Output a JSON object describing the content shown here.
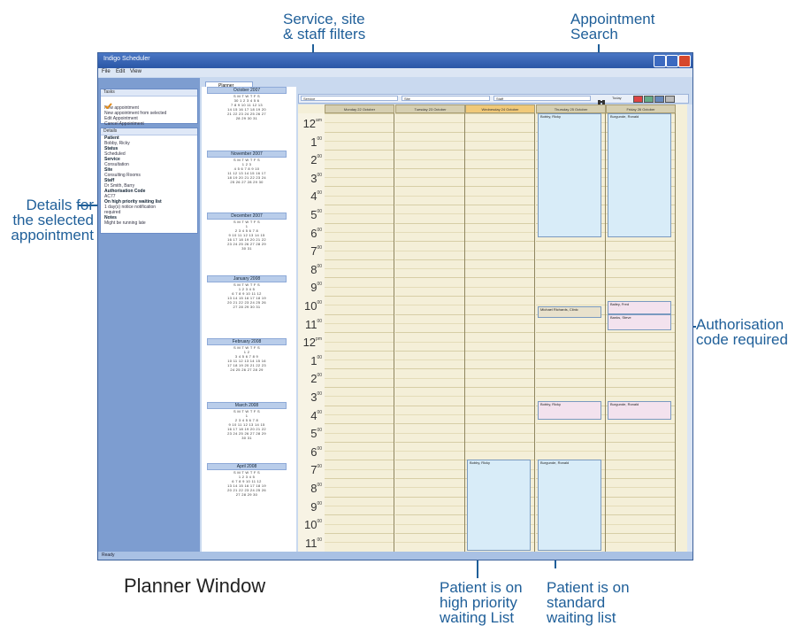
{
  "callouts": {
    "filters": "Service, site\n& staff filters",
    "filters_l1": "Service, site",
    "filters_l2": "& staff filters",
    "search_l1": "Appointment",
    "search_l2": "Search",
    "details_l1": "Details for",
    "details_l2": "the selected",
    "details_l3": "appointment",
    "auth_l1": "Authorisation",
    "auth_l2": "code required",
    "high_l1": "Patient is on",
    "high_l2": "high priority",
    "high_l3": "waiting List",
    "std_l1": "Patient is on",
    "std_l2": "standard",
    "std_l3": "waiting list",
    "caption": "Planner Window"
  },
  "window": {
    "title": "Indigo Scheduler",
    "menu": [
      "File",
      "Edit",
      "View"
    ],
    "status": "Ready"
  },
  "tasks": {
    "header": "Tasks",
    "items": [
      "New appointment",
      "New appointment from selected",
      "Edit Appointment",
      "Cancel Appointment"
    ]
  },
  "details": {
    "header": "Details",
    "lines": [
      {
        "t": "Patient",
        "b": true
      },
      {
        "t": "Bobby, Ricky",
        "b": false
      },
      {
        "t": "Status",
        "b": true
      },
      {
        "t": "Scheduled",
        "b": false
      },
      {
        "t": "Service",
        "b": true
      },
      {
        "t": "Consultation",
        "b": false
      },
      {
        "t": "Site",
        "b": true
      },
      {
        "t": "Consulting Rooms",
        "b": false
      },
      {
        "t": "Staff",
        "b": true
      },
      {
        "t": "Dr Smith, Barry",
        "b": false
      },
      {
        "t": "Authorisation Code",
        "b": true
      },
      {
        "t": "AC77",
        "b": false
      },
      {
        "t": "On high priority waiting list",
        "b": true
      },
      {
        "t": "1 day(s) notice notification",
        "b": false
      },
      {
        "t": "required",
        "b": false
      },
      {
        "t": "Notes",
        "b": true
      },
      {
        "t": "Might be running late",
        "b": false
      }
    ]
  },
  "tab": {
    "label": "Planner"
  },
  "filters": {
    "service": "Service",
    "site": "Site",
    "staff": "Staff",
    "today": "Today"
  },
  "months": [
    {
      "name": "October 2007",
      "rows": [
        "S M T W T F S",
        "30 1 2 3 4 5 6",
        "7 8 9 10 11 12 13",
        "14 15 16 17 18 19 20",
        "21 22 23 24 25 26 27",
        "28 29 30 31"
      ]
    },
    {
      "name": "November 2007",
      "rows": [
        "S M T W T F S",
        "1 2 3",
        "4 5 6 7 8 9 10",
        "11 12 13 14 15 16 17",
        "18 19 20 21 22 23 24",
        "25 26 27 28 29 30"
      ]
    },
    {
      "name": "December 2007",
      "rows": [
        "S M T W T F S",
        "1",
        "2 3 4 5 6 7 8",
        "9 10 11 12 13 14 15",
        "16 17 18 19 20 21 22",
        "23 24 25 26 27 28 29",
        "30 31"
      ]
    },
    {
      "name": "January 2008",
      "rows": [
        "S M T W T F S",
        "1 2 3 4 5",
        "6 7 8 9 10 11 12",
        "13 14 15 16 17 18 19",
        "20 21 22 23 24 25 26",
        "27 28 29 30 31"
      ]
    },
    {
      "name": "February 2008",
      "rows": [
        "S M T W T F S",
        "1 2",
        "3 4 5 6 7 8 9",
        "10 11 12 13 14 15 16",
        "17 18 19 20 21 22 23",
        "24 25 26 27 28 29"
      ]
    },
    {
      "name": "March 2008",
      "rows": [
        "S M T W T F S",
        "1",
        "2 3 4 5 6 7 8",
        "9 10 11 12 13 14 15",
        "16 17 18 19 20 21 22",
        "23 24 25 26 27 28 29",
        "30 31"
      ]
    },
    {
      "name": "April 2008",
      "rows": [
        "S M T W T F S",
        "1 2 3 4 5",
        "6 7 8 9 10 11 12",
        "13 14 15 16 17 18 19",
        "20 21 22 23 24 25 26",
        "27 28 29 30"
      ]
    }
  ],
  "days": [
    "Monday 22 October",
    "Tuesday 23 October",
    "Wednesday 24 October",
    "Thursday 25 October",
    "Friday 26 October"
  ],
  "hours": [
    {
      "h": "12",
      "s": "am"
    },
    {
      "h": "1",
      "s": "00"
    },
    {
      "h": "2",
      "s": "00"
    },
    {
      "h": "3",
      "s": "00"
    },
    {
      "h": "4",
      "s": "00"
    },
    {
      "h": "5",
      "s": "00"
    },
    {
      "h": "6",
      "s": "00"
    },
    {
      "h": "7",
      "s": "00"
    },
    {
      "h": "8",
      "s": "00"
    },
    {
      "h": "9",
      "s": "00"
    },
    {
      "h": "10",
      "s": "00"
    },
    {
      "h": "11",
      "s": "00"
    },
    {
      "h": "12",
      "s": "pm"
    },
    {
      "h": "1",
      "s": "00"
    },
    {
      "h": "2",
      "s": "00"
    },
    {
      "h": "3",
      "s": "00"
    },
    {
      "h": "4",
      "s": "00"
    },
    {
      "h": "5",
      "s": "00"
    },
    {
      "h": "6",
      "s": "00"
    },
    {
      "h": "7",
      "s": "00"
    },
    {
      "h": "8",
      "s": "00"
    },
    {
      "h": "9",
      "s": "00"
    },
    {
      "h": "10",
      "s": "00"
    },
    {
      "h": "11",
      "s": "00"
    }
  ],
  "appointments": {
    "a1": "Bobby, Ricky",
    "a2": "Burgunde, Ronald",
    "a3": "Michael Richards, Clinic",
    "a4": "Bailey, Fred",
    "a5": "Banks, Steve",
    "a6": "Bobby, Ricky",
    "a7": "Burgunde, Ronald",
    "a8": "Bobby, Ricky",
    "a9": "Burgunde, Ronald"
  }
}
